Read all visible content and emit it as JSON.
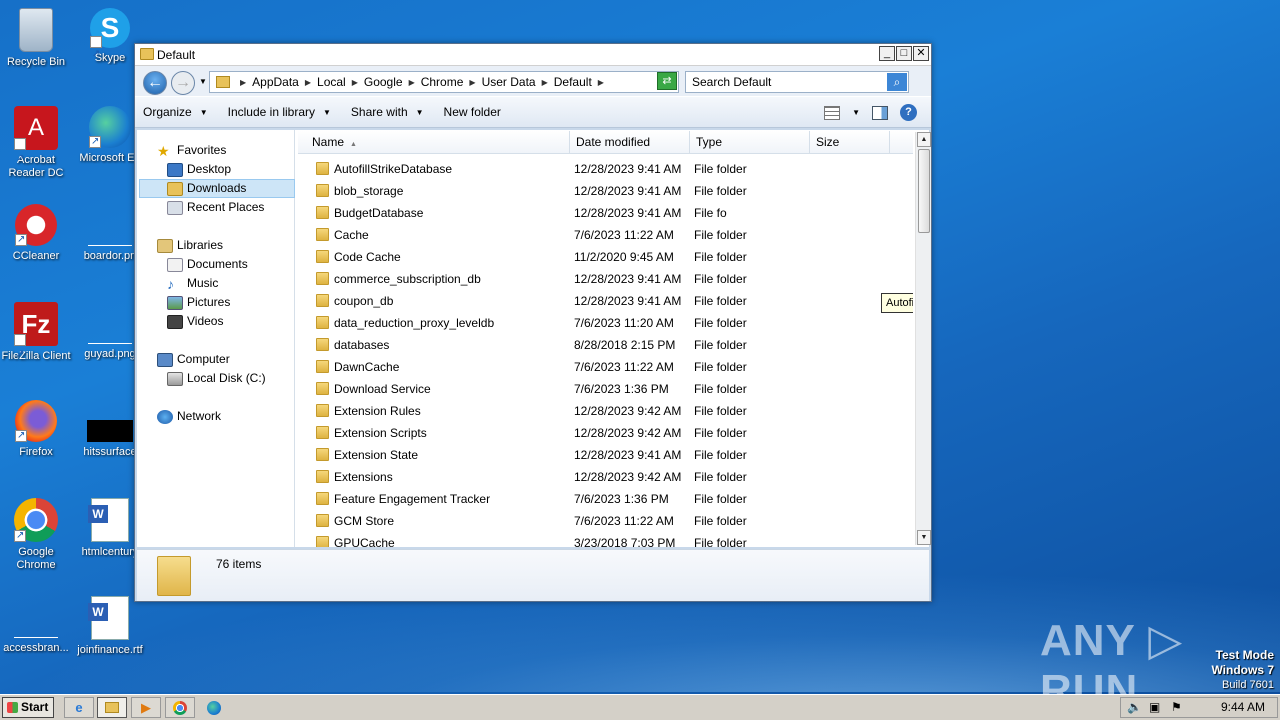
{
  "desktop": {
    "icons": [
      {
        "label": "Recycle Bin"
      },
      {
        "label": "Skype"
      },
      {
        "label": "Acrobat Reader DC"
      },
      {
        "label": "Microsoft Ed"
      },
      {
        "label": "CCleaner"
      },
      {
        "label": "boardor.pn"
      },
      {
        "label": "FileZilla Client"
      },
      {
        "label": "guyad.png"
      },
      {
        "label": "Firefox"
      },
      {
        "label": "hitssurface"
      },
      {
        "label": "Google Chrome"
      },
      {
        "label": "htmlcentury"
      },
      {
        "label": "accessbran..."
      },
      {
        "label": "joinfinance.rtf"
      }
    ]
  },
  "window": {
    "title": "Default",
    "controls": {
      "minimize": "_",
      "maximize": "□",
      "close": "✕"
    },
    "breadcrumb": [
      "AppData",
      "Local",
      "Google",
      "Chrome",
      "User Data",
      "Default"
    ],
    "search_placeholder": "Search Default",
    "toolbar": {
      "organize": "Organize",
      "include_in_library": "Include in library",
      "share_with": "Share with",
      "new_folder": "New folder"
    },
    "nav": {
      "favorites": "Favorites",
      "desktop": "Desktop",
      "downloads": "Downloads",
      "recent_places": "Recent Places",
      "libraries": "Libraries",
      "documents": "Documents",
      "music": "Music",
      "pictures": "Pictures",
      "videos": "Videos",
      "computer": "Computer",
      "local_disk": "Local Disk (C:)",
      "network": "Network"
    },
    "columns": {
      "name": "Name",
      "date": "Date modified",
      "type": "Type",
      "size": "Size"
    },
    "files": [
      {
        "name": "AutofillStrikeDatabase",
        "date": "12/28/2023 9:41 AM",
        "type": "File folder"
      },
      {
        "name": "blob_storage",
        "date": "12/28/2023 9:41 AM",
        "type": "File folder"
      },
      {
        "name": "BudgetDatabase",
        "date": "12/28/2023 9:41 AM",
        "type": "File fo"
      },
      {
        "name": "Cache",
        "date": "7/6/2023 11:22 AM",
        "type": "File folder"
      },
      {
        "name": "Code Cache",
        "date": "11/2/2020 9:45 AM",
        "type": "File folder"
      },
      {
        "name": "commerce_subscription_db",
        "date": "12/28/2023 9:41 AM",
        "type": "File folder"
      },
      {
        "name": "coupon_db",
        "date": "12/28/2023 9:41 AM",
        "type": "File folder"
      },
      {
        "name": "data_reduction_proxy_leveldb",
        "date": "7/6/2023 11:20 AM",
        "type": "File folder"
      },
      {
        "name": "databases",
        "date": "8/28/2018 2:15 PM",
        "type": "File folder"
      },
      {
        "name": "DawnCache",
        "date": "7/6/2023 11:22 AM",
        "type": "File folder"
      },
      {
        "name": "Download Service",
        "date": "7/6/2023 1:36 PM",
        "type": "File folder"
      },
      {
        "name": "Extension Rules",
        "date": "12/28/2023 9:42 AM",
        "type": "File folder"
      },
      {
        "name": "Extension Scripts",
        "date": "12/28/2023 9:42 AM",
        "type": "File folder"
      },
      {
        "name": "Extension State",
        "date": "12/28/2023 9:41 AM",
        "type": "File folder"
      },
      {
        "name": "Extensions",
        "date": "12/28/2023 9:42 AM",
        "type": "File folder"
      },
      {
        "name": "Feature Engagement Tracker",
        "date": "7/6/2023 1:36 PM",
        "type": "File folder"
      },
      {
        "name": "GCM Store",
        "date": "7/6/2023 11:22 AM",
        "type": "File folder"
      },
      {
        "name": "GPUCache",
        "date": "3/23/2018 7:03 PM",
        "type": "File folder"
      }
    ],
    "tooltip": "AutofillStrikeDatabase",
    "item_count": "76 items"
  },
  "watermark": {
    "brand": "ANY ▷ RUN",
    "mode": "Test Mode",
    "os": "Windows 7",
    "build": "Build 7601"
  },
  "taskbar": {
    "start": "Start",
    "clock": "9:44 AM"
  }
}
